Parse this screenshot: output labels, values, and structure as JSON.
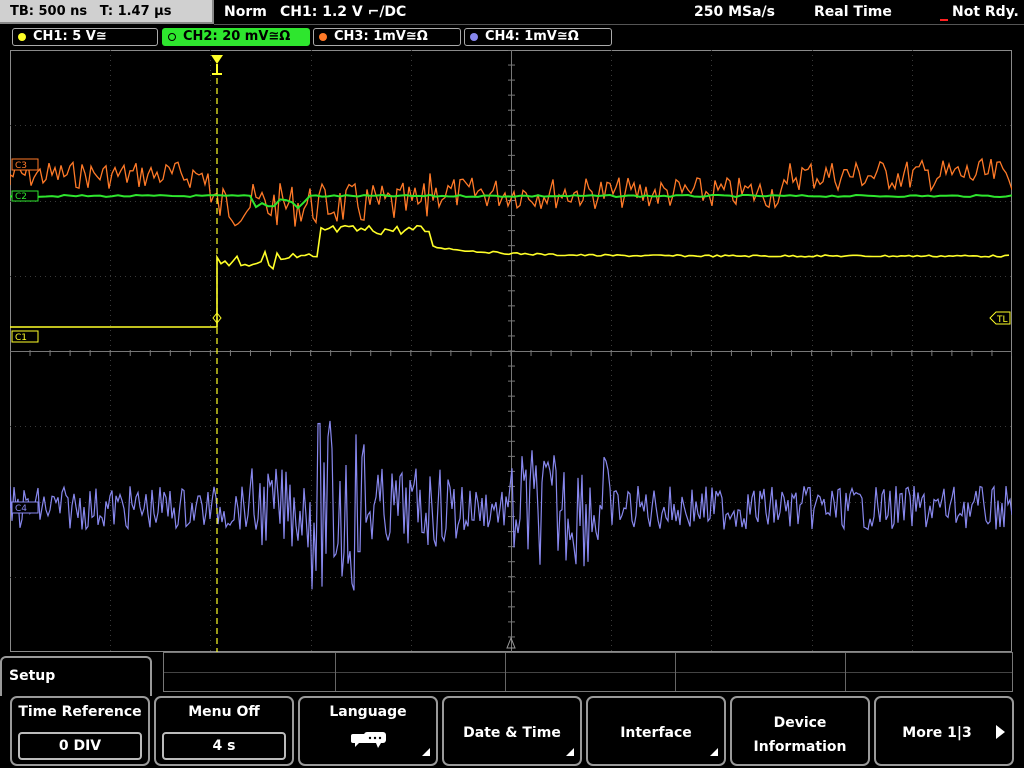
{
  "status": {
    "timebase": "TB: 500 ns",
    "trigger_time": "T: 1.47 µs",
    "mode": "Norm",
    "trigger": "CH1: 1.2 V ⌐/DC",
    "sample_rate": "250 MSa/s",
    "acq_mode": "Real Time",
    "state": "Not Rdy."
  },
  "channels": [
    {
      "label": "CH1: 5 V≅",
      "color": "#ffff28"
    },
    {
      "label": "CH2: 20 mV≅Ω",
      "color": "#2ee62e"
    },
    {
      "label": "CH3: 1mV≅Ω",
      "color": "#ff7a28"
    },
    {
      "label": "CH4: 1mV≅Ω",
      "color": "#8888ee"
    }
  ],
  "markers": {
    "c1": "C1",
    "c2": "C2",
    "c3": "C3",
    "c4": "C4",
    "trigger_level": "TL"
  },
  "menu": {
    "title": "Setup",
    "softkeys": [
      {
        "label": "Time Reference",
        "value": "0 DIV"
      },
      {
        "label": "Menu Off",
        "value": "4 s"
      },
      {
        "label": "Language",
        "icon": "speech-bubbles-icon"
      },
      {
        "label": "Date & Time"
      },
      {
        "label": "Interface"
      },
      {
        "label_line1": "Device",
        "label_line2": "Information"
      },
      {
        "label": "More 1|3"
      }
    ]
  }
}
